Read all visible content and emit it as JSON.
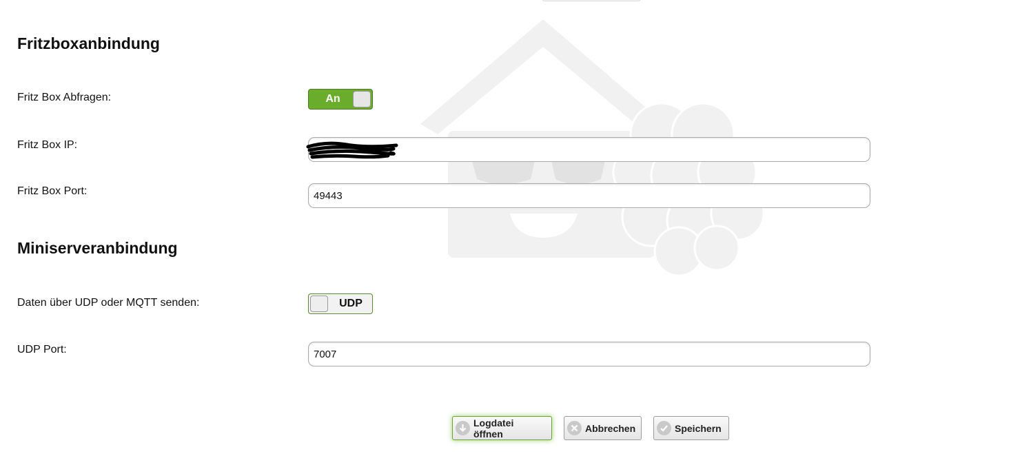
{
  "sections": {
    "fritzbox_title": "Fritzboxanbindung",
    "miniserver_title": "Miniserveranbindung"
  },
  "fields": {
    "fritz_query_label": "Fritz Box Abfragen:",
    "fritz_query_toggle": "An",
    "fritz_ip_label": "Fritz Box IP:",
    "fritz_ip_value": "",
    "fritz_port_label": "Fritz Box Port:",
    "fritz_port_value": "49443",
    "protocol_label": "Daten über UDP oder MQTT senden:",
    "protocol_toggle": "UDP",
    "udp_port_label": "UDP Port:",
    "udp_port_value": "7007"
  },
  "buttons": {
    "logfile": "Logdatei öffnen",
    "cancel": "Abbrechen",
    "save": "Speichern"
  },
  "colors": {
    "accent_green": "#6aad2c",
    "toggle_border": "#4f7a24"
  },
  "icons": {
    "logfile": "arrow-down-circle-icon",
    "cancel": "x-circle-icon",
    "save": "check-circle-icon",
    "background": "house-raspberry-logo"
  }
}
